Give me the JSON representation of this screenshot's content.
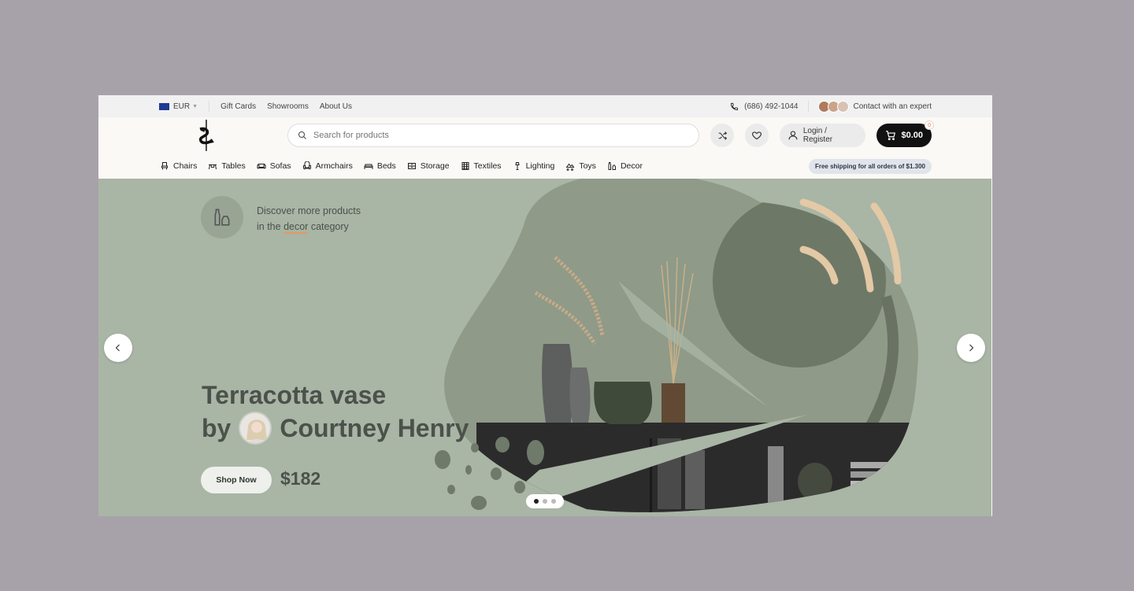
{
  "topbar": {
    "currency": "EUR",
    "links": [
      "Gift Cards",
      "Showrooms",
      "About Us"
    ],
    "phone": "(686) 492-1044",
    "contact": "Contact with an expert"
  },
  "header": {
    "search_placeholder": "Search for products",
    "login_label": "Login / Register",
    "cart_total": "$0.00",
    "cart_count": "0"
  },
  "nav": {
    "items": [
      {
        "label": "Chairs",
        "icon": "chair-icon"
      },
      {
        "label": "Tables",
        "icon": "table-icon"
      },
      {
        "label": "Sofas",
        "icon": "sofa-icon"
      },
      {
        "label": "Armchairs",
        "icon": "armchair-icon"
      },
      {
        "label": "Beds",
        "icon": "bed-icon"
      },
      {
        "label": "Storage",
        "icon": "storage-icon"
      },
      {
        "label": "Textiles",
        "icon": "textiles-icon"
      },
      {
        "label": "Lighting",
        "icon": "lamp-icon"
      },
      {
        "label": "Toys",
        "icon": "toy-icon"
      },
      {
        "label": "Decor",
        "icon": "vase-icon"
      }
    ],
    "shipping_badge": "Free shipping for all orders of $1.300"
  },
  "hero": {
    "discover_line1": "Discover more products",
    "discover_line2_pre": "in the",
    "discover_highlight": "decor",
    "discover_line2_post": "category",
    "title_line1": "Terracotta vase",
    "title_by": "by",
    "title_author": "Courtney Henry",
    "shop_button": "Shop Now",
    "price": "$182",
    "slides": 3,
    "active_slide": 1
  },
  "colors": {
    "hero_bg": "#a9b5a5",
    "cart_bg": "#111111",
    "accent_underline": "#e39a5c"
  }
}
